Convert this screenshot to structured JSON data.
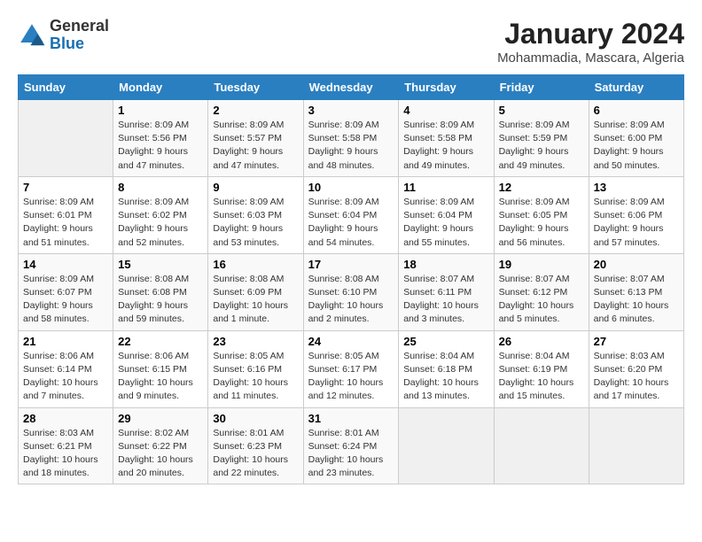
{
  "header": {
    "logo_line1": "General",
    "logo_line2": "Blue",
    "title": "January 2024",
    "subtitle": "Mohammadia, Mascara, Algeria"
  },
  "columns": [
    "Sunday",
    "Monday",
    "Tuesday",
    "Wednesday",
    "Thursday",
    "Friday",
    "Saturday"
  ],
  "weeks": [
    [
      {
        "day": "",
        "sunrise": "",
        "sunset": "",
        "daylight": ""
      },
      {
        "day": "1",
        "sunrise": "Sunrise: 8:09 AM",
        "sunset": "Sunset: 5:56 PM",
        "daylight": "Daylight: 9 hours and 47 minutes."
      },
      {
        "day": "2",
        "sunrise": "Sunrise: 8:09 AM",
        "sunset": "Sunset: 5:57 PM",
        "daylight": "Daylight: 9 hours and 47 minutes."
      },
      {
        "day": "3",
        "sunrise": "Sunrise: 8:09 AM",
        "sunset": "Sunset: 5:58 PM",
        "daylight": "Daylight: 9 hours and 48 minutes."
      },
      {
        "day": "4",
        "sunrise": "Sunrise: 8:09 AM",
        "sunset": "Sunset: 5:58 PM",
        "daylight": "Daylight: 9 hours and 49 minutes."
      },
      {
        "day": "5",
        "sunrise": "Sunrise: 8:09 AM",
        "sunset": "Sunset: 5:59 PM",
        "daylight": "Daylight: 9 hours and 49 minutes."
      },
      {
        "day": "6",
        "sunrise": "Sunrise: 8:09 AM",
        "sunset": "Sunset: 6:00 PM",
        "daylight": "Daylight: 9 hours and 50 minutes."
      }
    ],
    [
      {
        "day": "7",
        "sunrise": "Sunrise: 8:09 AM",
        "sunset": "Sunset: 6:01 PM",
        "daylight": "Daylight: 9 hours and 51 minutes."
      },
      {
        "day": "8",
        "sunrise": "Sunrise: 8:09 AM",
        "sunset": "Sunset: 6:02 PM",
        "daylight": "Daylight: 9 hours and 52 minutes."
      },
      {
        "day": "9",
        "sunrise": "Sunrise: 8:09 AM",
        "sunset": "Sunset: 6:03 PM",
        "daylight": "Daylight: 9 hours and 53 minutes."
      },
      {
        "day": "10",
        "sunrise": "Sunrise: 8:09 AM",
        "sunset": "Sunset: 6:04 PM",
        "daylight": "Daylight: 9 hours and 54 minutes."
      },
      {
        "day": "11",
        "sunrise": "Sunrise: 8:09 AM",
        "sunset": "Sunset: 6:04 PM",
        "daylight": "Daylight: 9 hours and 55 minutes."
      },
      {
        "day": "12",
        "sunrise": "Sunrise: 8:09 AM",
        "sunset": "Sunset: 6:05 PM",
        "daylight": "Daylight: 9 hours and 56 minutes."
      },
      {
        "day": "13",
        "sunrise": "Sunrise: 8:09 AM",
        "sunset": "Sunset: 6:06 PM",
        "daylight": "Daylight: 9 hours and 57 minutes."
      }
    ],
    [
      {
        "day": "14",
        "sunrise": "Sunrise: 8:09 AM",
        "sunset": "Sunset: 6:07 PM",
        "daylight": "Daylight: 9 hours and 58 minutes."
      },
      {
        "day": "15",
        "sunrise": "Sunrise: 8:08 AM",
        "sunset": "Sunset: 6:08 PM",
        "daylight": "Daylight: 9 hours and 59 minutes."
      },
      {
        "day": "16",
        "sunrise": "Sunrise: 8:08 AM",
        "sunset": "Sunset: 6:09 PM",
        "daylight": "Daylight: 10 hours and 1 minute."
      },
      {
        "day": "17",
        "sunrise": "Sunrise: 8:08 AM",
        "sunset": "Sunset: 6:10 PM",
        "daylight": "Daylight: 10 hours and 2 minutes."
      },
      {
        "day": "18",
        "sunrise": "Sunrise: 8:07 AM",
        "sunset": "Sunset: 6:11 PM",
        "daylight": "Daylight: 10 hours and 3 minutes."
      },
      {
        "day": "19",
        "sunrise": "Sunrise: 8:07 AM",
        "sunset": "Sunset: 6:12 PM",
        "daylight": "Daylight: 10 hours and 5 minutes."
      },
      {
        "day": "20",
        "sunrise": "Sunrise: 8:07 AM",
        "sunset": "Sunset: 6:13 PM",
        "daylight": "Daylight: 10 hours and 6 minutes."
      }
    ],
    [
      {
        "day": "21",
        "sunrise": "Sunrise: 8:06 AM",
        "sunset": "Sunset: 6:14 PM",
        "daylight": "Daylight: 10 hours and 7 minutes."
      },
      {
        "day": "22",
        "sunrise": "Sunrise: 8:06 AM",
        "sunset": "Sunset: 6:15 PM",
        "daylight": "Daylight: 10 hours and 9 minutes."
      },
      {
        "day": "23",
        "sunrise": "Sunrise: 8:05 AM",
        "sunset": "Sunset: 6:16 PM",
        "daylight": "Daylight: 10 hours and 11 minutes."
      },
      {
        "day": "24",
        "sunrise": "Sunrise: 8:05 AM",
        "sunset": "Sunset: 6:17 PM",
        "daylight": "Daylight: 10 hours and 12 minutes."
      },
      {
        "day": "25",
        "sunrise": "Sunrise: 8:04 AM",
        "sunset": "Sunset: 6:18 PM",
        "daylight": "Daylight: 10 hours and 13 minutes."
      },
      {
        "day": "26",
        "sunrise": "Sunrise: 8:04 AM",
        "sunset": "Sunset: 6:19 PM",
        "daylight": "Daylight: 10 hours and 15 minutes."
      },
      {
        "day": "27",
        "sunrise": "Sunrise: 8:03 AM",
        "sunset": "Sunset: 6:20 PM",
        "daylight": "Daylight: 10 hours and 17 minutes."
      }
    ],
    [
      {
        "day": "28",
        "sunrise": "Sunrise: 8:03 AM",
        "sunset": "Sunset: 6:21 PM",
        "daylight": "Daylight: 10 hours and 18 minutes."
      },
      {
        "day": "29",
        "sunrise": "Sunrise: 8:02 AM",
        "sunset": "Sunset: 6:22 PM",
        "daylight": "Daylight: 10 hours and 20 minutes."
      },
      {
        "day": "30",
        "sunrise": "Sunrise: 8:01 AM",
        "sunset": "Sunset: 6:23 PM",
        "daylight": "Daylight: 10 hours and 22 minutes."
      },
      {
        "day": "31",
        "sunrise": "Sunrise: 8:01 AM",
        "sunset": "Sunset: 6:24 PM",
        "daylight": "Daylight: 10 hours and 23 minutes."
      },
      {
        "day": "",
        "sunrise": "",
        "sunset": "",
        "daylight": ""
      },
      {
        "day": "",
        "sunrise": "",
        "sunset": "",
        "daylight": ""
      },
      {
        "day": "",
        "sunrise": "",
        "sunset": "",
        "daylight": ""
      }
    ]
  ]
}
